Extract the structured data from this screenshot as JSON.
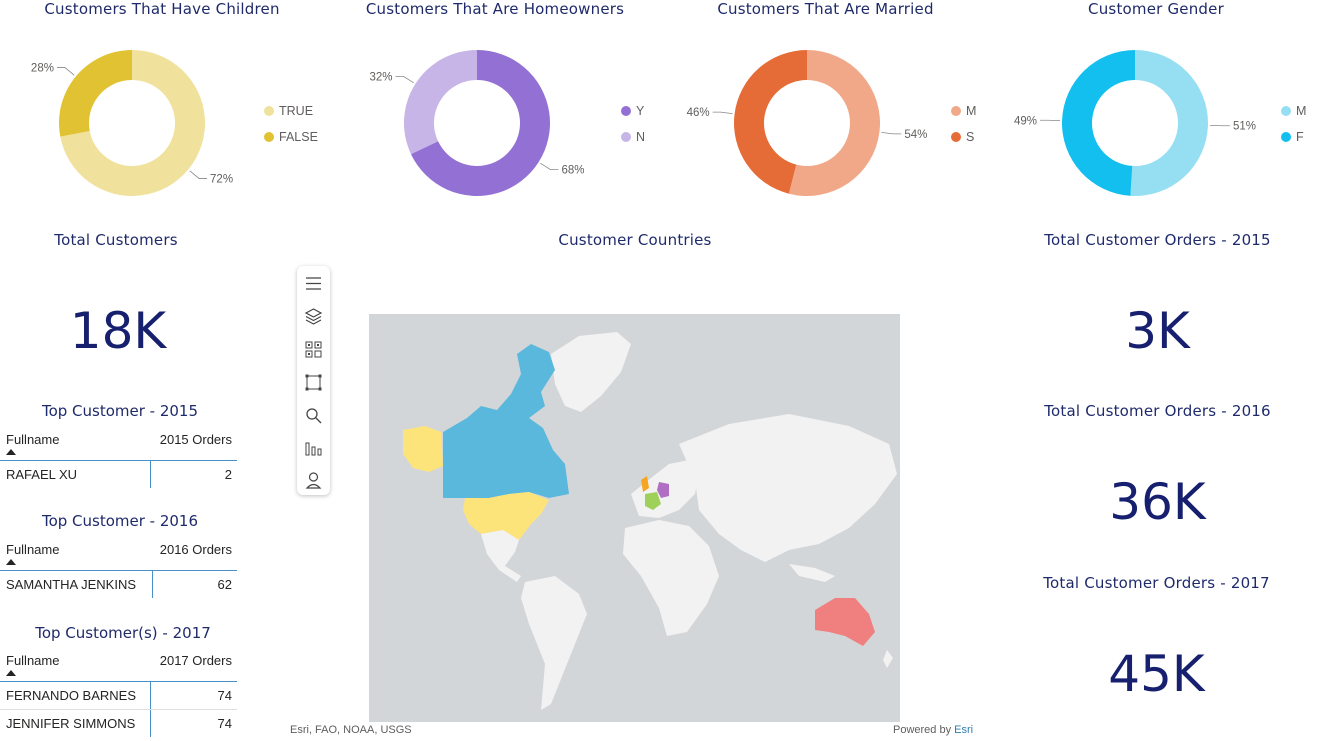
{
  "colors": {
    "title": "#1f2a6b",
    "kpi": "#17206e",
    "children_true": "#f0e19c",
    "children_false": "#e1c233",
    "home_y": "#9370d4",
    "home_n": "#c6b5e6",
    "married_m": "#f0a888",
    "married_s": "#e66c37",
    "gender_m": "#96dff3",
    "gender_f": "#12bfef",
    "map_ocean": "#d3d6d8",
    "map_land": "#f2f2f2",
    "map_canada": "#5ab8dc",
    "map_usa": "#fde47a",
    "map_australia": "#f08080",
    "map_germany": "#b06fc2",
    "map_france": "#9ed05a",
    "map_uk": "#f5a623"
  },
  "chart_data": [
    {
      "type": "pie",
      "title": "Customers That Have Children",
      "series": [
        {
          "name": "TRUE",
          "value": 72,
          "label": "72%"
        },
        {
          "name": "FALSE",
          "value": 28,
          "label": "28%"
        }
      ]
    },
    {
      "type": "pie",
      "title": "Customers That Are Homeowners",
      "series": [
        {
          "name": "Y",
          "value": 68,
          "label": "68%"
        },
        {
          "name": "N",
          "value": 32,
          "label": "32%"
        }
      ]
    },
    {
      "type": "pie",
      "title": "Customers That Are Married",
      "series": [
        {
          "name": "M",
          "value": 54,
          "label": "54%"
        },
        {
          "name": "S",
          "value": 46,
          "label": "46%"
        }
      ]
    },
    {
      "type": "pie",
      "title": "Customer Gender",
      "series": [
        {
          "name": "M",
          "value": 51,
          "label": "51%"
        },
        {
          "name": "F",
          "value": 49,
          "label": "49%"
        }
      ]
    },
    {
      "type": "table",
      "title": "Top Customer - 2015",
      "columns": [
        "Fullname",
        "2015 Orders"
      ],
      "rows": [
        [
          "RAFAEL XU",
          "2"
        ]
      ]
    },
    {
      "type": "table",
      "title": "Top Customer - 2016",
      "columns": [
        "Fullname",
        "2016 Orders"
      ],
      "rows": [
        [
          "SAMANTHA JENKINS",
          "62"
        ]
      ]
    },
    {
      "type": "table",
      "title": "Top Customer(s) - 2017",
      "columns": [
        "Fullname",
        "2017 Orders"
      ],
      "rows": [
        [
          "FERNANDO BARNES",
          "74"
        ],
        [
          "JENNIFER SIMMONS",
          "74"
        ]
      ]
    }
  ],
  "kpis": {
    "total_customers": {
      "title": "Total Customers",
      "value": "18K"
    },
    "orders_2015": {
      "title": "Total Customer Orders - 2015",
      "value": "3K"
    },
    "orders_2016": {
      "title": "Total Customer Orders - 2016",
      "value": "36K"
    },
    "orders_2017": {
      "title": "Total Customer Orders - 2017",
      "value": "45K"
    }
  },
  "map": {
    "title": "Customer Countries",
    "attribution": "Esri, FAO, NOAA, USGS",
    "powered_prefix": "Powered by ",
    "powered_brand": "Esri",
    "toolbar_icons": [
      "menu-icon",
      "layers-icon",
      "qr-select-icon",
      "rect-select-icon",
      "search-icon",
      "bar-chart-icon",
      "pin-icon"
    ]
  }
}
